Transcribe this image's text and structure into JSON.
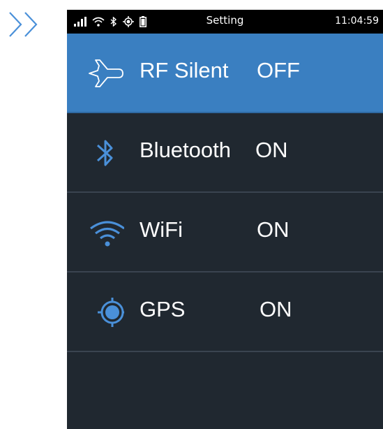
{
  "statusbar": {
    "title": "Setting",
    "time": "11:04:59",
    "icons": [
      "signal-icon",
      "wifi-icon",
      "bluetooth-icon",
      "gps-icon",
      "battery-icon"
    ]
  },
  "settings": [
    {
      "icon": "airplane-icon",
      "label": "RF Silent",
      "value": "OFF",
      "selected": true
    },
    {
      "icon": "bluetooth-icon",
      "label": "Bluetooth",
      "value": "ON",
      "selected": false
    },
    {
      "icon": "wifi-icon",
      "label": "WiFi",
      "value": "ON",
      "selected": false
    },
    {
      "icon": "gps-icon",
      "label": "GPS",
      "value": "ON",
      "selected": false
    }
  ],
  "colors": {
    "accent": "#3a7fc1",
    "icon_blue": "#4a90d9",
    "background": "#202830",
    "statusbar": "#000000"
  }
}
